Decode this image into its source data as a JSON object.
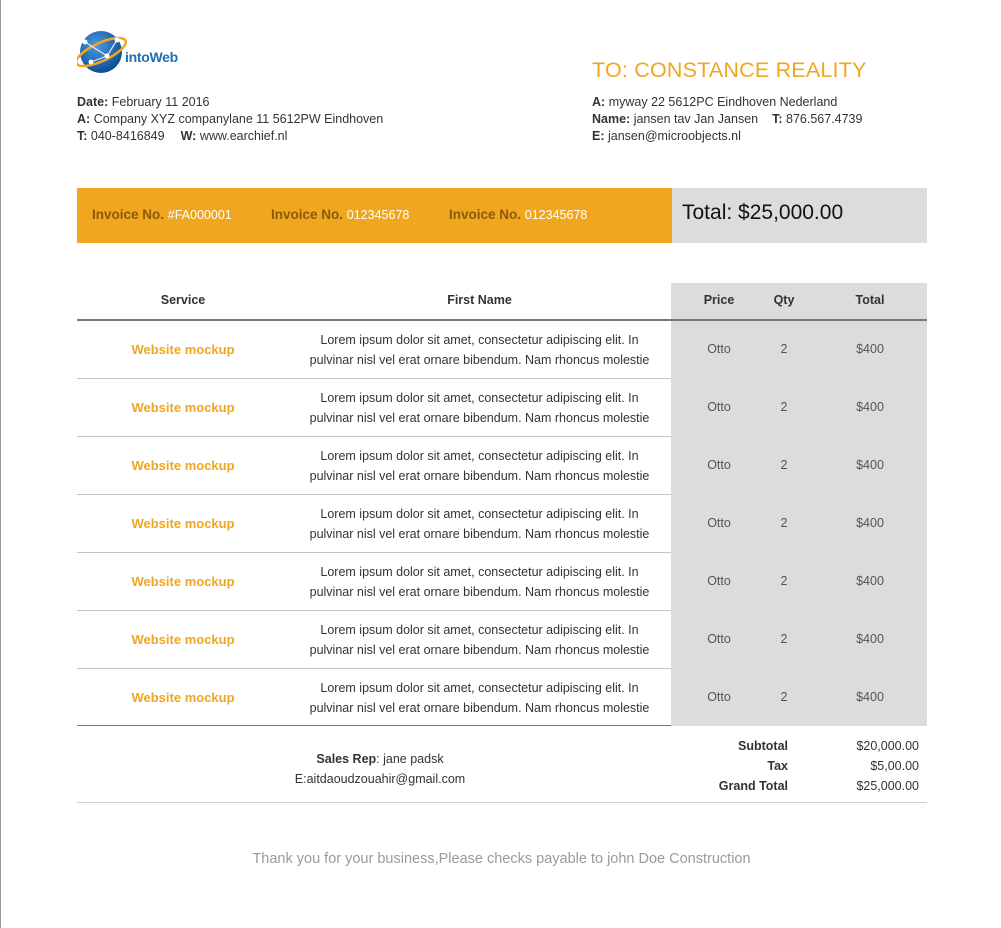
{
  "brand": {
    "logo_text": "intoWeb",
    "accent_color": "#f0a61e",
    "logo_blue": "#1f6fb5"
  },
  "sender": {
    "date_label": "Date:",
    "date_value": "February 11 2016",
    "address_label": "A:",
    "address_value": "Company XYZ companylane 11 5612PW Eindhoven",
    "phone_label": "T:",
    "phone_value": "040-8416849",
    "web_label": "W:",
    "web_value": "www.earchief.nl"
  },
  "recipient": {
    "title": "TO: CONSTANCE REALITY",
    "address_label": "A:",
    "address_value": "myway 22 5612PC Eindhoven Nederland",
    "name_label": "Name:",
    "name_value": "jansen tav Jan Jansen",
    "phone_label": "T:",
    "phone_value": "876.567.4739",
    "email_label": "E:",
    "email_value": "jansen@microobjects.nl"
  },
  "invoice_bar": {
    "items": [
      {
        "label": "Invoice No.",
        "value": "#FA000001"
      },
      {
        "label": "Invoice No.",
        "value": "012345678"
      },
      {
        "label": "Invoice No.",
        "value": "012345678"
      }
    ],
    "total_text": "Total: $25,000.00"
  },
  "table": {
    "headers": {
      "service": "Service",
      "first_name": "First Name",
      "price": "Price",
      "qty": "Qty",
      "total": "Total"
    },
    "rows": [
      {
        "service": "Website mockup",
        "desc1": "Lorem ipsum dolor sit amet, consectetur adipiscing elit. In",
        "desc2": "pulvinar nisl vel erat ornare bibendum. Nam rhoncus molestie",
        "price": "Otto",
        "qty": "2",
        "total": "$400"
      },
      {
        "service": "Website mockup",
        "desc1": "Lorem ipsum dolor sit amet, consectetur adipiscing elit. In",
        "desc2": "pulvinar nisl vel erat ornare bibendum. Nam rhoncus molestie",
        "price": "Otto",
        "qty": "2",
        "total": "$400"
      },
      {
        "service": "Website mockup",
        "desc1": "Lorem ipsum dolor sit amet, consectetur adipiscing elit. In",
        "desc2": "pulvinar nisl vel erat ornare bibendum. Nam rhoncus molestie",
        "price": "Otto",
        "qty": "2",
        "total": "$400"
      },
      {
        "service": "Website mockup",
        "desc1": "Lorem ipsum dolor sit amet, consectetur adipiscing elit. In",
        "desc2": "pulvinar nisl vel erat ornare bibendum. Nam rhoncus molestie",
        "price": "Otto",
        "qty": "2",
        "total": "$400"
      },
      {
        "service": "Website mockup",
        "desc1": "Lorem ipsum dolor sit amet, consectetur adipiscing elit. In",
        "desc2": "pulvinar nisl vel erat ornare bibendum. Nam rhoncus molestie",
        "price": "Otto",
        "qty": "2",
        "total": "$400"
      },
      {
        "service": "Website mockup",
        "desc1": "Lorem ipsum dolor sit amet, consectetur adipiscing elit. In",
        "desc2": "pulvinar nisl vel erat ornare bibendum. Nam rhoncus molestie",
        "price": "Otto",
        "qty": "2",
        "total": "$400"
      },
      {
        "service": "Website mockup",
        "desc1": "Lorem ipsum dolor sit amet, consectetur adipiscing elit. In",
        "desc2": "pulvinar nisl vel erat ornare bibendum. Nam rhoncus molestie",
        "price": "Otto",
        "qty": "2",
        "total": "$400"
      }
    ]
  },
  "summary": {
    "sales_rep_label": "Sales Rep",
    "sales_rep_value": ": jane padsk",
    "email_line": "E:aitdaoudzouahir@gmail.com",
    "subtotal_label": "Subtotal",
    "subtotal_value": "$20,000.00",
    "tax_label": "Tax",
    "tax_value": "$5,00.00",
    "grand_total_label": "Grand Total",
    "grand_total_value": "$25,000.00"
  },
  "footer": {
    "thanks": "Thank you for your business,Please checks payable to john Doe Construction"
  }
}
